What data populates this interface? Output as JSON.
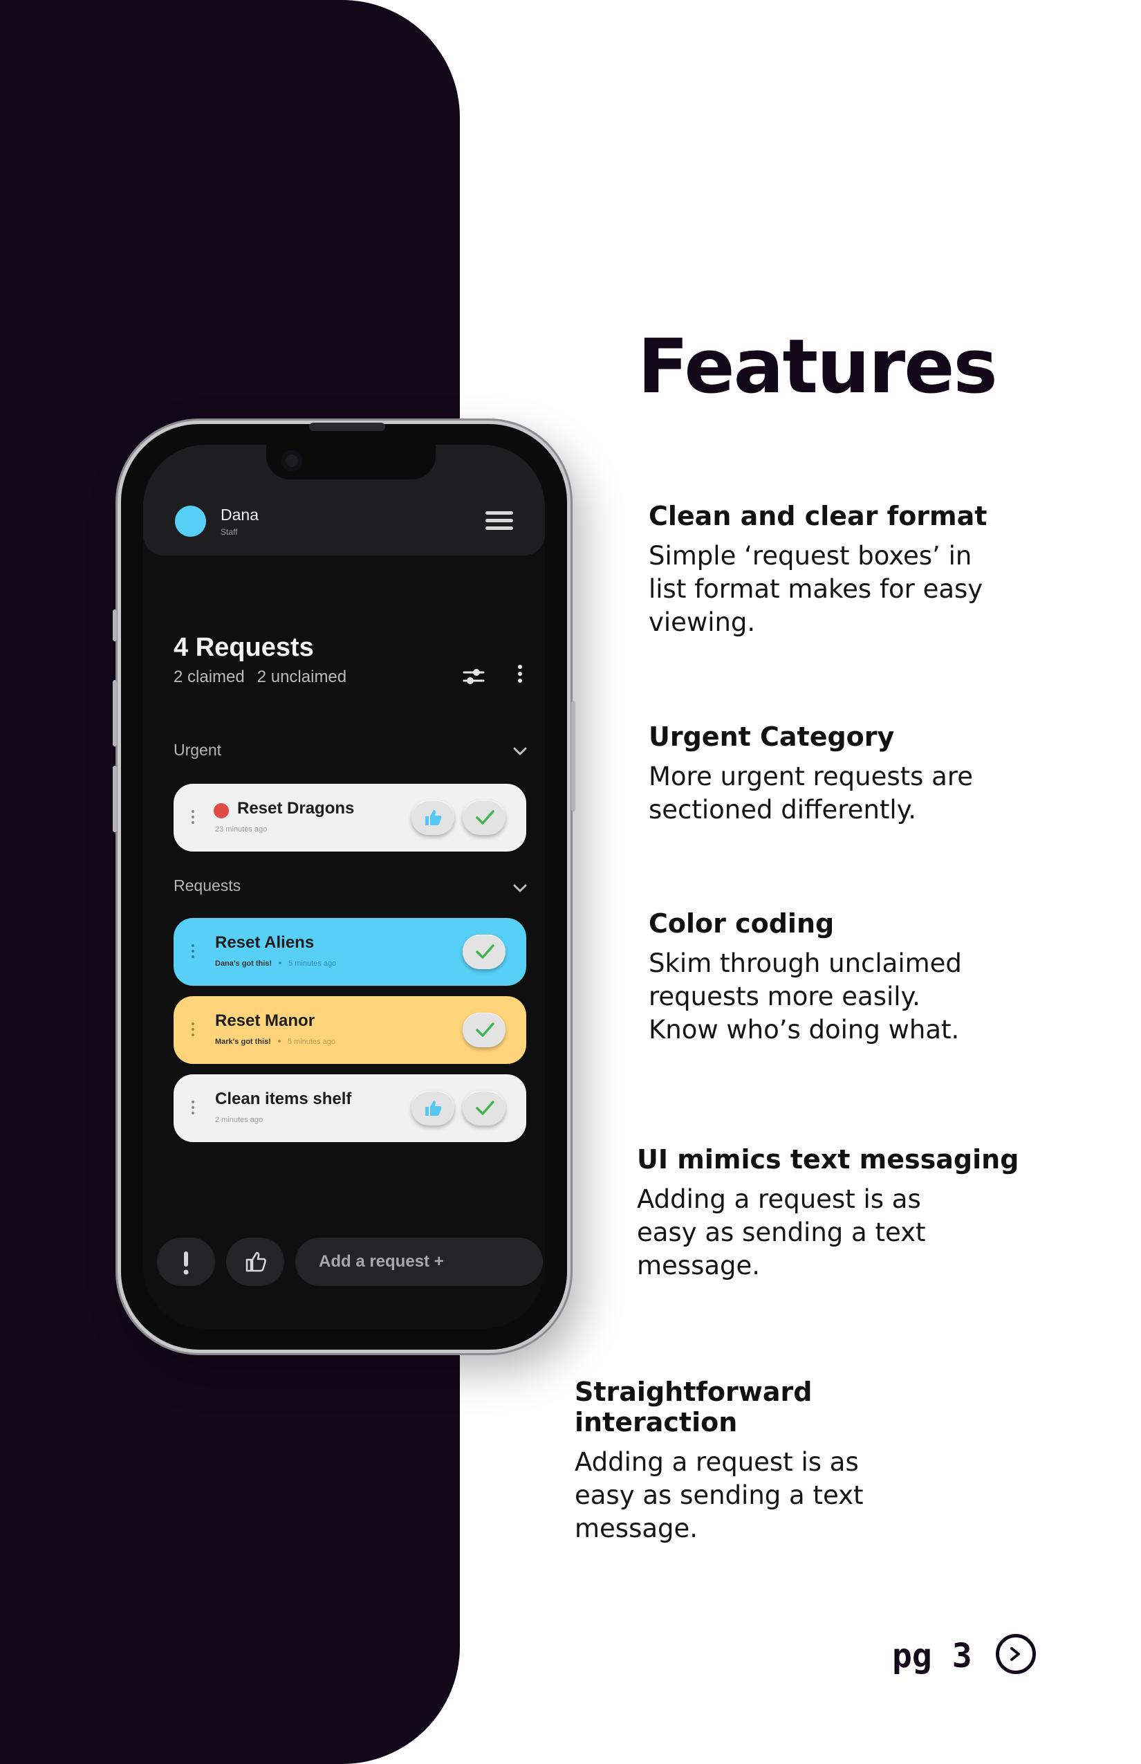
{
  "app": {
    "user_name": "Dana",
    "user_role": "Staff",
    "requests_title": "4 Requests",
    "claimed": "2 claimed",
    "unclaimed": "2 unclaimed",
    "urgent_label": "Urgent",
    "requests_label": "Requests",
    "add_placeholder": "Add a request +",
    "colors": {
      "accent_blue": "#58cff6",
      "accent_yellow": "#ffd47a",
      "urgent_red": "#e04a44",
      "card_light": "#f1f1f1"
    },
    "urgent_cards": [
      {
        "title": "Reset Dragons",
        "time": "23 minutes ago"
      }
    ],
    "request_cards": [
      {
        "title": "Reset Aliens",
        "claimed_by": "Dana's got this!",
        "time": "5 minutes ago"
      },
      {
        "title": "Reset Manor",
        "claimed_by": "Mark's got this!",
        "time": "5 minutes ago"
      },
      {
        "title": "Clean items shelf",
        "time": "2 minutes ago"
      }
    ]
  },
  "page": {
    "title": "Features",
    "features": [
      {
        "heading": "Clean and clear format",
        "lines": [
          "Simple ‘request boxes’ in",
          "list format makes for easy",
          "viewing."
        ]
      },
      {
        "heading": "Urgent Category",
        "lines": [
          "More urgent requests are",
          "sectioned differently."
        ]
      },
      {
        "heading": "Color coding",
        "lines": [
          "Skim through unclaimed",
          "requests more easily.",
          "Know who’s doing what."
        ]
      },
      {
        "heading": "UI mimics text messaging",
        "lines": [
          "Adding a request is as",
          "easy as sending a text",
          "message."
        ]
      },
      {
        "heading": "Straightforward interaction",
        "lines": [
          "Adding a request is as",
          "easy as sending a text",
          "message."
        ]
      }
    ],
    "page_number": "pg 3"
  }
}
